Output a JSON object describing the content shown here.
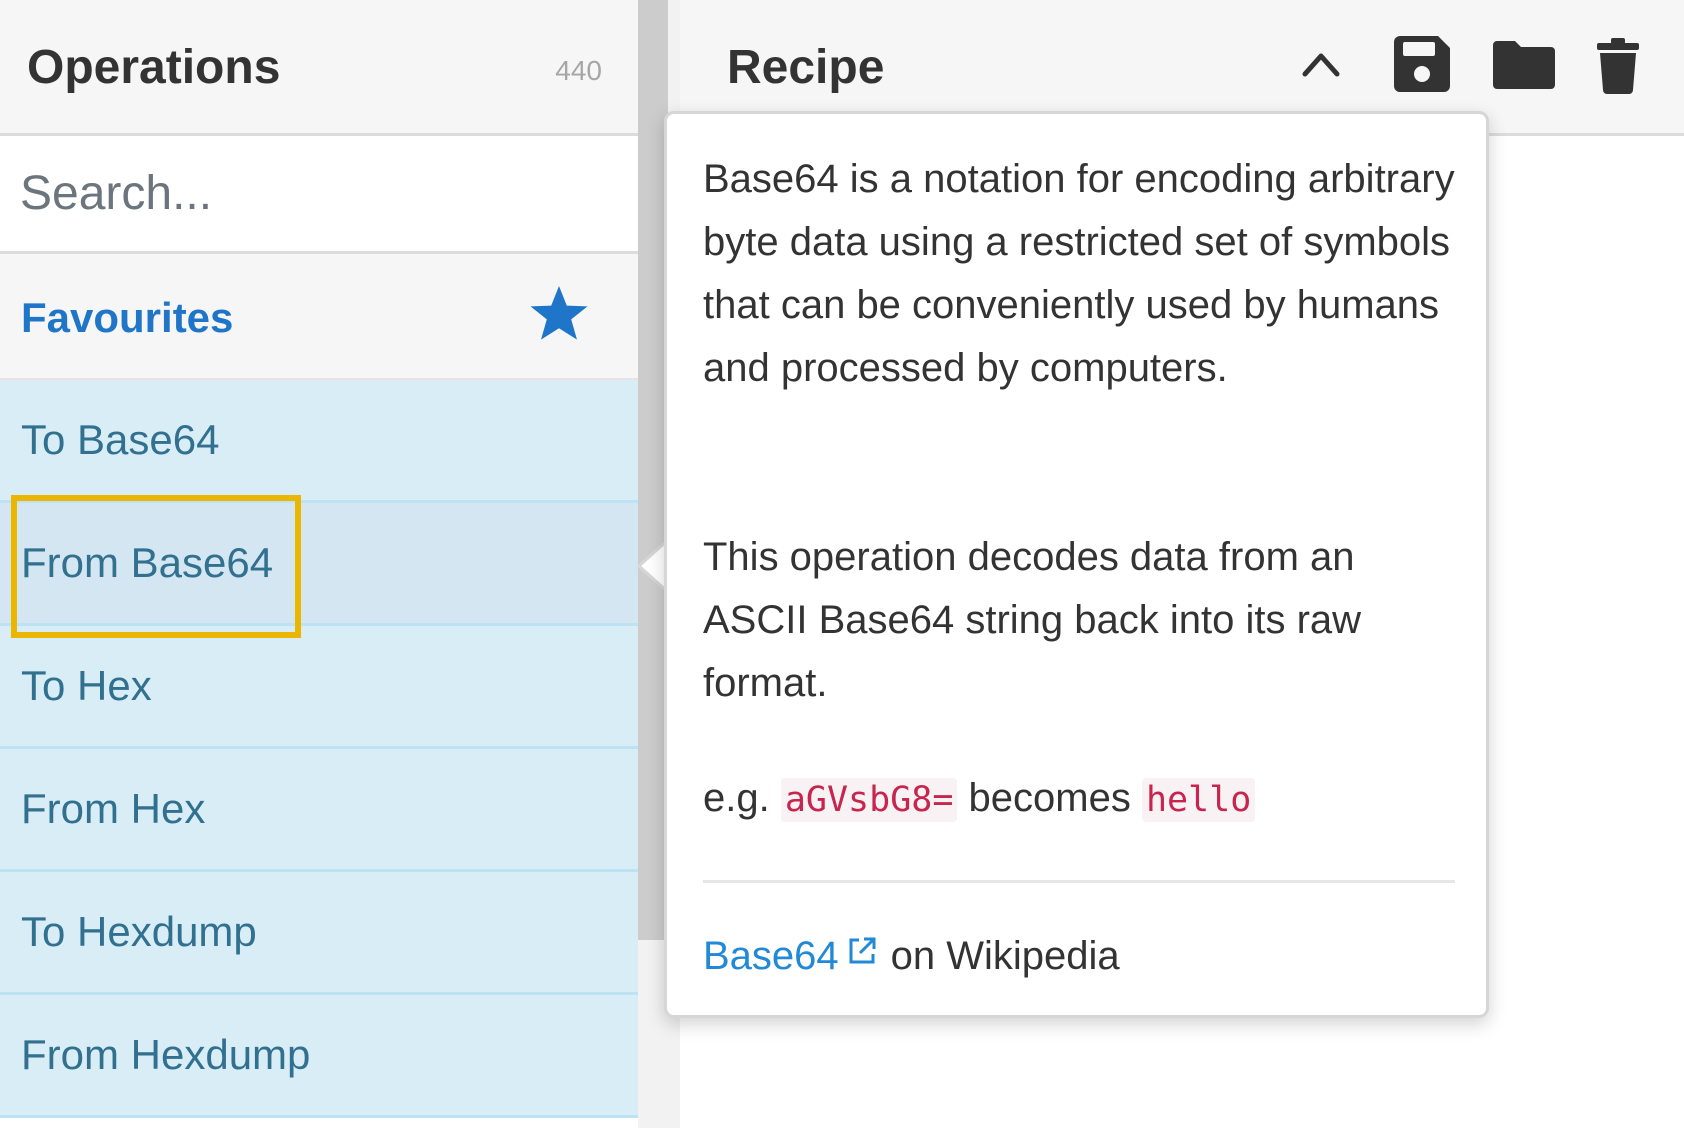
{
  "operations": {
    "title": "Operations",
    "count": "440",
    "search_placeholder": "Search...",
    "favourites_label": "Favourites",
    "favourites_icon": "star-icon",
    "items": [
      {
        "label": "To Base64"
      },
      {
        "label": "From Base64",
        "state": "hovered"
      },
      {
        "label": "To Hex"
      },
      {
        "label": "From Hex"
      },
      {
        "label": "To Hexdump"
      },
      {
        "label": "From Hexdump"
      }
    ]
  },
  "recipe": {
    "title": "Recipe",
    "buttons": [
      {
        "name": "collapse",
        "icon": "chevron-up-icon"
      },
      {
        "name": "save",
        "icon": "save-icon"
      },
      {
        "name": "load",
        "icon": "folder-icon"
      },
      {
        "name": "clear",
        "icon": "trash-icon"
      }
    ]
  },
  "popover": {
    "description": "Base64 is a notation for encoding arbitrary byte data using a restricted set of symbols that can be conveniently used by humans and processed by computers.",
    "operation_text": "This operation decodes data from an ASCII Base64 string back into its raw format.",
    "example": {
      "prefix": "e.g.",
      "input": "aGVsbG8=",
      "middle": "becomes",
      "output": "hello"
    },
    "link": {
      "label": "Base64",
      "icon": "external-link-icon",
      "suffix": "on Wikipedia"
    }
  },
  "colors": {
    "accent": "#1f76c9",
    "favourite_item_bg": "#d9edf7",
    "favourite_item_text": "#31708f",
    "highlight_border": "#eab600",
    "code_text": "#c7254e",
    "link": "#2189d6"
  }
}
